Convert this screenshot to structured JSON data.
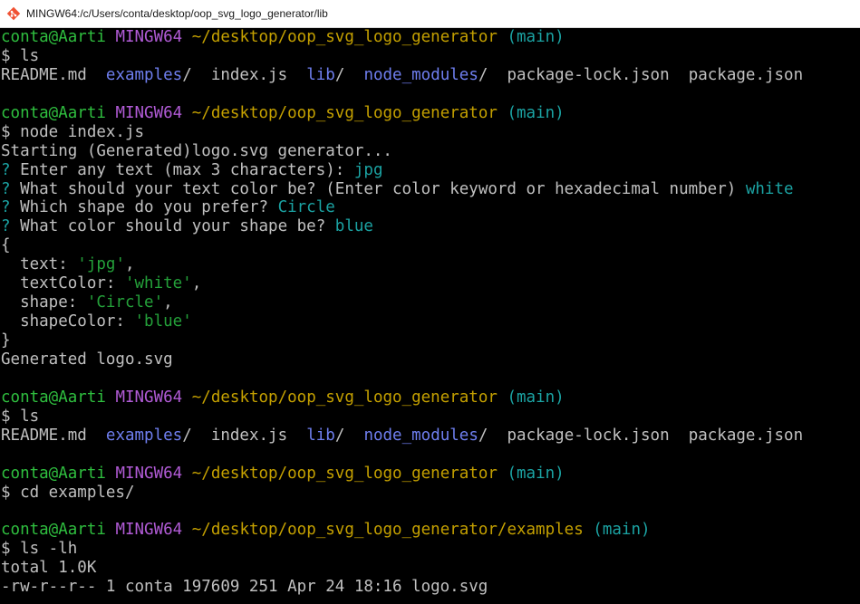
{
  "window": {
    "title": "MINGW64:/c/Users/conta/desktop/oop_svg_logo_generator/lib"
  },
  "prompt": {
    "user_host": "conta@Aarti",
    "shell": "MINGW64",
    "path_root": "~/desktop/oop_svg_logo_generator",
    "path_examples": "~/desktop/oop_svg_logo_generator/examples",
    "branch": "(main)"
  },
  "commands": {
    "ls": "$ ls",
    "node": "$ node index.js",
    "cd": "$ cd examples/",
    "ls_lh": "$ ls -lh"
  },
  "listing": {
    "readme": "README.md",
    "examples": "examples",
    "index": "index.js",
    "lib": "lib",
    "node_modules": "node_modules",
    "lock": "package-lock.json",
    "pkg": "package.json",
    "slash": "/"
  },
  "output": {
    "starting": "Starting (Generated)logo.svg generator...",
    "q_mark": "?",
    "q1": "Enter any text (max 3 characters):",
    "a1": "jpg",
    "q2": "What should your text color be? (Enter color keyword or hexadecimal number)",
    "a2": "white",
    "q3": "Which shape do you prefer?",
    "a3": "Circle",
    "q4": "What color should your shape be?",
    "a4": "blue",
    "brace_open": "{",
    "brace_close": "}",
    "k_text": "  text: ",
    "v_text": "'jpg'",
    "k_textColor": "  textColor: ",
    "v_textColor": "'white'",
    "k_shape": "  shape: ",
    "v_shape": "'Circle'",
    "k_shapeColor": "  shapeColor: ",
    "v_shapeColor": "'blue'",
    "comma": ",",
    "generated": "Generated logo.svg",
    "total": "total 1.0K",
    "ls_entry": "-rw-r--r-- 1 conta 197609 251 Apr 24 18:16 logo.svg"
  },
  "colors": {
    "background": "#000000",
    "text": "#c0c0c0",
    "user": "#2fbf3f",
    "host": "#b15bd6",
    "path": "#c4a000",
    "branch": "#1ba3a3",
    "directory": "#6f7ff0",
    "string": "#24a13a"
  },
  "icons": {
    "app": "git-bash-icon"
  }
}
